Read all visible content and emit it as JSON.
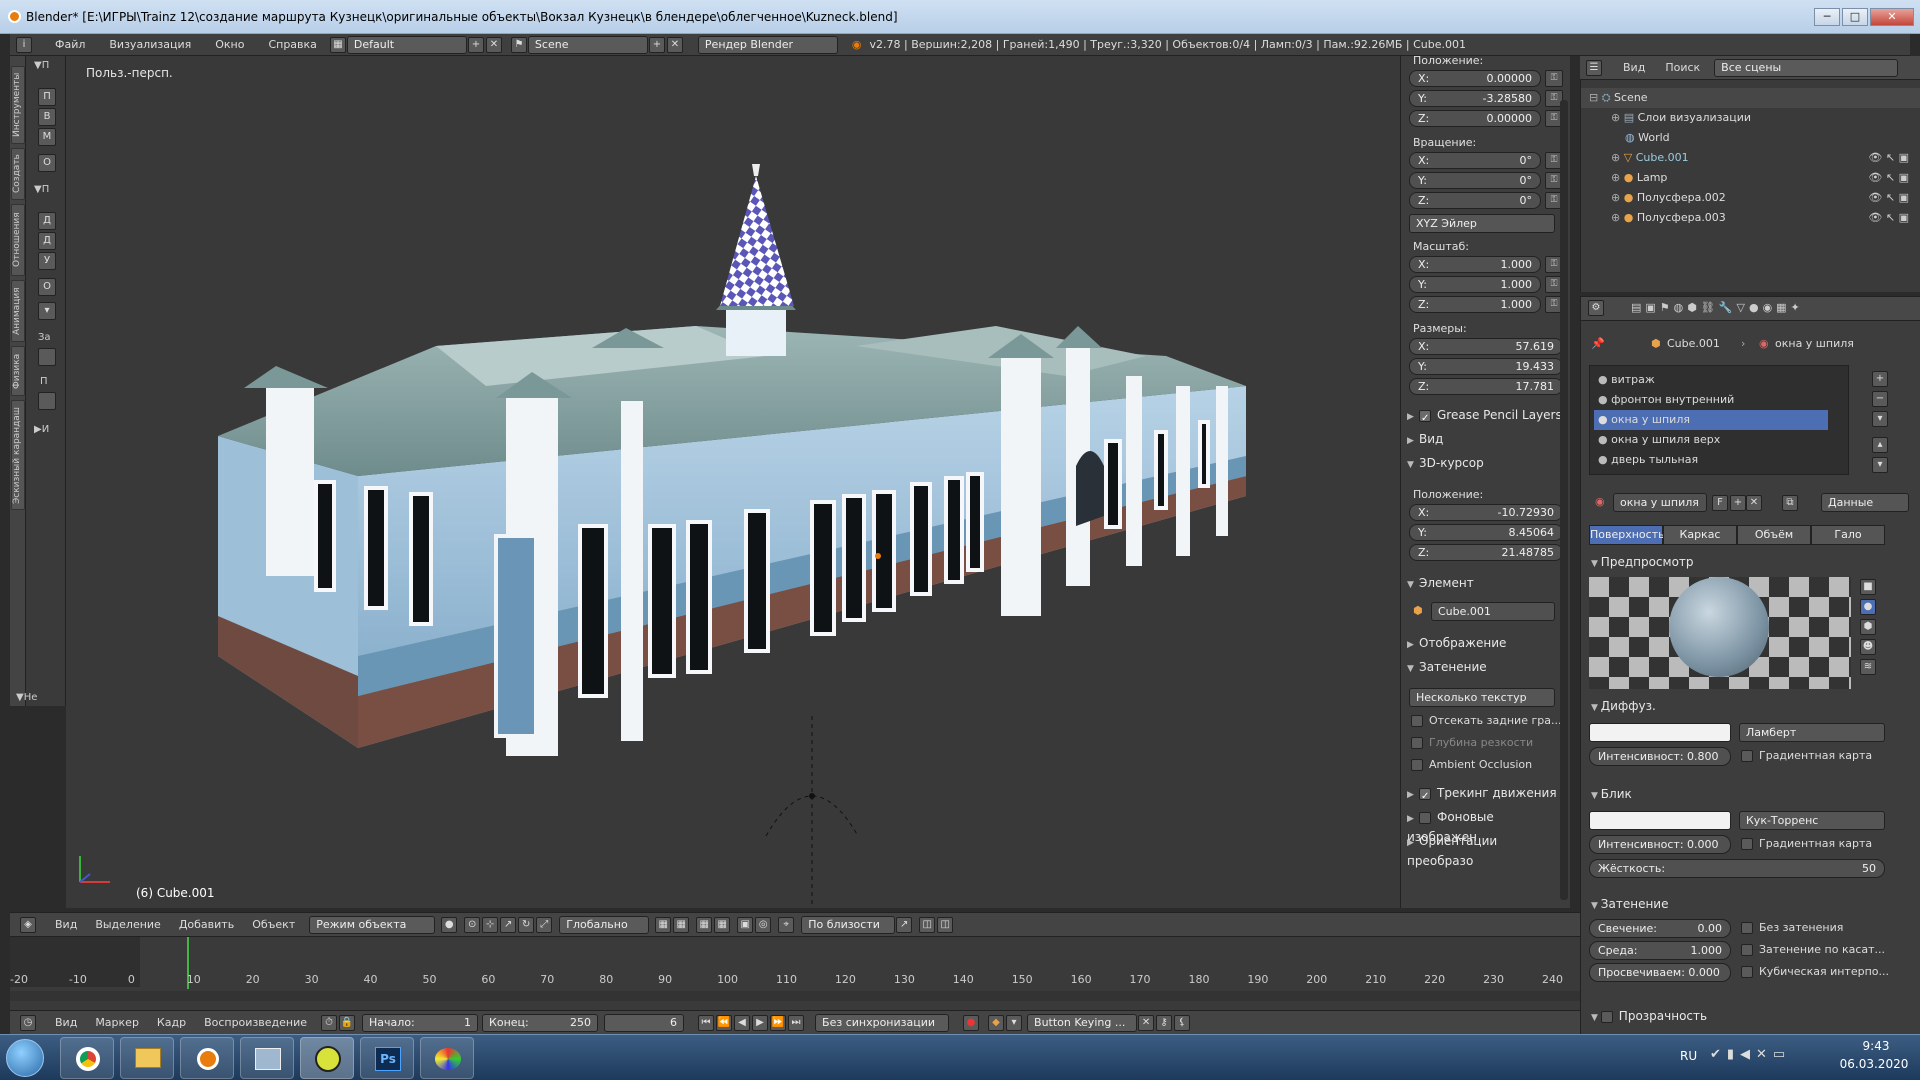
{
  "window": {
    "title": "Blender* [E:\\ИГРЫ\\Trainz 12\\создание маршрута Кузнецк\\оригинальные объекты\\Вокзал Кузнецк\\в блендере\\облегченное\\Kuzneck.blend]",
    "min": "─",
    "max": "□",
    "close": "✕"
  },
  "infobar": {
    "menus": [
      "Файл",
      "Визуализация",
      "Окно",
      "Справка"
    ],
    "layout": "Default",
    "scene": "Scene",
    "render_engine": "Рендер Blender",
    "stats": "v2.78 | Вершин:2,208 | Граней:1,490 | Треуг.:3,320 | Объектов:0/4 | Ламп:0/3 | Пам.:92.26МБ | Cube.001"
  },
  "toolshelf": {
    "tabs": [
      "Инструменты",
      "Создать",
      "Отношения",
      "Анимация",
      "Физика",
      "Эскизный карандаш"
    ],
    "buttons": [
      "П",
      "В",
      "М",
      "О",
      "Д",
      "Д",
      "У",
      "О",
      "За",
      "П"
    ],
    "section_markers": [
      "▼П",
      "▼П",
      "▶И",
      "▼Не"
    ]
  },
  "viewport": {
    "label": "Польз.-персп.",
    "object_label": "(6) Cube.001"
  },
  "nprops": {
    "location_label": "Положение:",
    "location": [
      {
        "axis": "X:",
        "value": "0.00000"
      },
      {
        "axis": "Y:",
        "value": "-3.28580"
      },
      {
        "axis": "Z:",
        "value": "0.00000"
      }
    ],
    "rotation_label": "Вращение:",
    "rotation": [
      {
        "axis": "X:",
        "value": "0°"
      },
      {
        "axis": "Y:",
        "value": "0°"
      },
      {
        "axis": "Z:",
        "value": "0°"
      }
    ],
    "rotation_mode": "XYZ Эйлер",
    "scale_label": "Масштаб:",
    "scale": [
      {
        "axis": "X:",
        "value": "1.000"
      },
      {
        "axis": "Y:",
        "value": "1.000"
      },
      {
        "axis": "Z:",
        "value": "1.000"
      }
    ],
    "dimensions_label": "Размеры:",
    "dimensions": [
      {
        "axis": "X:",
        "value": "57.619"
      },
      {
        "axis": "Y:",
        "value": "19.433"
      },
      {
        "axis": "Z:",
        "value": "17.781"
      }
    ],
    "grease_pencil": "Grease Pencil Layers",
    "view": "Вид",
    "cursor": "3D-курсор",
    "cursor_location_label": "Положение:",
    "cursor_location": [
      {
        "axis": "X:",
        "value": "-10.72930"
      },
      {
        "axis": "Y:",
        "value": "8.45064"
      },
      {
        "axis": "Z:",
        "value": "21.48785"
      }
    ],
    "item": "Элемент",
    "item_name": "Cube.001",
    "display": "Отображение",
    "shading": "Затенение",
    "shading_mode": "Несколько текстур",
    "backface": "Отсекать задние гра...",
    "dof": "Глубина резкости",
    "ao": "Ambient Occlusion",
    "motion_tracking": "Трекинг движения",
    "background_images": "Фоновые изображен",
    "transform_orientations": "Ориентации преобразо"
  },
  "outliner": {
    "view": "Вид",
    "search": "Поиск",
    "filter": "Все сцены",
    "rows": [
      {
        "label": "Scene",
        "indent": 1
      },
      {
        "label": "Слои визуализации",
        "indent": 2
      },
      {
        "label": "World",
        "indent": 2
      },
      {
        "label": "Cube.001",
        "indent": 2
      },
      {
        "label": "Lamp",
        "indent": 2
      },
      {
        "label": "Полусфера.002",
        "indent": 2
      },
      {
        "label": "Полусфера.003",
        "indent": 2
      }
    ]
  },
  "props": {
    "breadcrumb_obj": "Cube.001",
    "breadcrumb_mat": "окна у шпиля",
    "materials": [
      "витраж",
      "фронтон внутренний",
      "окна у шпиля",
      "окна у шпиля верх",
      "дверь тыльная"
    ],
    "selected_material": "окна у шпиля",
    "mat_field": "окна у шпиля",
    "mat_f": "F",
    "data_dd": "Данные",
    "tabs": [
      "Поверхность",
      "Каркас",
      "Объём",
      "Гало"
    ],
    "preview": "Предпросмотр",
    "diffuse": "Диффуз.",
    "diffuse_shader": "Ламберт",
    "diffuse_intensity": "Интенсивност: 0.800",
    "ramp": "Градиентная карта",
    "specular": "Блик",
    "specular_shader": "Кук-Торренс",
    "specular_intensity": "Интенсивност: 0.000",
    "ramp2": "Градиентная карта",
    "hardness_label": "Жёсткость:",
    "hardness_value": "50",
    "shading": "Затенение",
    "emit": "Свечение:",
    "emit_value": "0.00",
    "ambient": "Среда:",
    "ambient_value": "1.000",
    "translucency": "Просвечиваем: 0.000",
    "shadeless": "Без затенения",
    "tangent": "Затенение по касат...",
    "cubic": "Кубическая интерпо...",
    "transparency": "Прозрачность"
  },
  "viewport_header": {
    "menus": [
      "Вид",
      "Выделение",
      "Добавить",
      "Объект"
    ],
    "mode": "Режим объекта",
    "orientation": "Глобально",
    "snap": "По близости"
  },
  "timeline": {
    "ticks": [
      "-20",
      "-10",
      "0",
      "10",
      "20",
      "30",
      "40",
      "50",
      "60",
      "70",
      "80",
      "90",
      "100",
      "110",
      "120",
      "130",
      "140",
      "150",
      "160",
      "170",
      "180",
      "190",
      "200",
      "210",
      "220",
      "230",
      "240"
    ],
    "current_frame_fraction": 0.053
  },
  "timeline_header": {
    "menus": [
      "Вид",
      "Маркер",
      "Кадр",
      "Воспроизведение"
    ],
    "start_label": "Начало:",
    "start_value": "1",
    "end_label": "Конец:",
    "end_value": "250",
    "current": "6",
    "sync": "Без синхронизации",
    "keying": "Button Keying ..."
  },
  "taskbar": {
    "lang": "RU",
    "time": "9:43",
    "date": "06.03.2020"
  }
}
